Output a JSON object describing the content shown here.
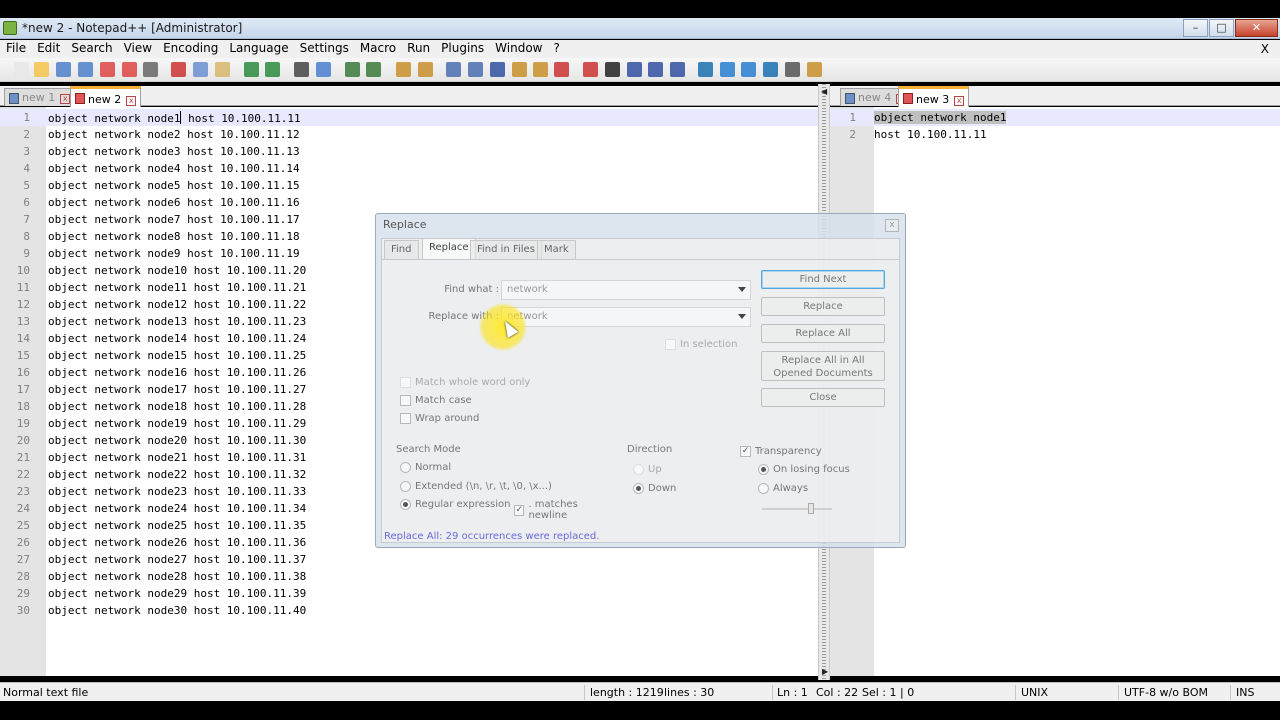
{
  "window": {
    "title": "*new  2 - Notepad++ [Administrator]"
  },
  "menu": [
    "File",
    "Edit",
    "Search",
    "View",
    "Encoding",
    "Language",
    "Settings",
    "Macro",
    "Run",
    "Plugins",
    "Window",
    "?"
  ],
  "menu_close_glyph": "X",
  "toolbar_icons": [
    "new-file",
    "open-file",
    "save",
    "save-all",
    "close",
    "close-all",
    "print",
    "cut",
    "copy",
    "paste",
    "undo",
    "redo",
    "find",
    "replace",
    "zoom-in",
    "zoom-out",
    "sync-vertical",
    "sync-horizontal",
    "word-wrap",
    "show-all-chars",
    "indent-guide",
    "user-lang",
    "doc-map",
    "function-list",
    "record-macro",
    "stop-record",
    "play-macro",
    "run-macro-multiple",
    "save-macro",
    "bookmark-toggle",
    "bookmark-prev",
    "bookmark-next",
    "bookmark-clear",
    "spell-check",
    "launch"
  ],
  "left_pane": {
    "tabs": [
      {
        "label": "new  1",
        "active": false
      },
      {
        "label": "new  2",
        "active": true
      }
    ],
    "lines": [
      "object network node1 host 10.100.11.11",
      "object network node2 host 10.100.11.12",
      "object network node3 host 10.100.11.13",
      "object network node4 host 10.100.11.14",
      "object network node5 host 10.100.11.15",
      "object network node6 host 10.100.11.16",
      "object network node7 host 10.100.11.17",
      "object network node8 host 10.100.11.18",
      "object network node9 host 10.100.11.19",
      "object network node10 host 10.100.11.20",
      "object network node11 host 10.100.11.21",
      "object network node12 host 10.100.11.22",
      "object network node13 host 10.100.11.23",
      "object network node14 host 10.100.11.24",
      "object network node15 host 10.100.11.25",
      "object network node16 host 10.100.11.26",
      "object network node17 host 10.100.11.27",
      "object network node18 host 10.100.11.28",
      "object network node19 host 10.100.11.29",
      "object network node20 host 10.100.11.30",
      "object network node21 host 10.100.11.31",
      "object network node22 host 10.100.11.32",
      "object network node23 host 10.100.11.33",
      "object network node24 host 10.100.11.34",
      "object network node25 host 10.100.11.35",
      "object network node26 host 10.100.11.36",
      "object network node27 host 10.100.11.37",
      "object network node28 host 10.100.11.38",
      "object network node29 host 10.100.11.39",
      "object network node30 host 10.100.11.40"
    ]
  },
  "right_pane": {
    "tabs": [
      {
        "label": "new  4",
        "active": false
      },
      {
        "label": "new  3",
        "active": true
      }
    ],
    "lines": [
      "object network node1",
      "host 10.100.11.11"
    ]
  },
  "replace_dialog": {
    "title": "Replace",
    "close_glyph": "x",
    "tabs": [
      "Find",
      "Replace",
      "Find in Files",
      "Mark"
    ],
    "active_tab": "Replace",
    "find_what_label": "Find what :",
    "find_what_value": "network",
    "replace_with_label": "Replace with :",
    "replace_with_value": "network",
    "in_selection_label": "In selection",
    "buttons": {
      "find_next": "Find Next",
      "replace": "Replace",
      "replace_all": "Replace All",
      "replace_all_opened": "Replace All in All Opened Documents",
      "close": "Close"
    },
    "options": {
      "match_whole_word": "Match whole word only",
      "match_case": "Match case",
      "wrap_around": "Wrap around"
    },
    "search_mode": {
      "title": "Search Mode",
      "normal": "Normal",
      "extended": "Extended (\\n, \\r, \\t, \\0, \\x...)",
      "regex": "Regular expression",
      "matches_newline": ". matches newline",
      "selected": "regex"
    },
    "direction": {
      "title": "Direction",
      "up": "Up",
      "down": "Down",
      "selected": "down"
    },
    "transparency": {
      "title": "Transparency",
      "on_losing_focus": "On losing focus",
      "always": "Always",
      "selected": "on_losing_focus",
      "checked": true
    },
    "status_message": "Replace All: 29 occurrences were replaced."
  },
  "statusbar": {
    "file_type": "Normal text file",
    "length": "length : 1219",
    "lines": "lines : 30",
    "ln": "Ln : 1",
    "col": "Col : 22",
    "sel": "Sel : 1 | 0",
    "eol": "UNIX",
    "encoding": "UTF-8 w/o BOM",
    "mode": "INS"
  },
  "split_arrows": {
    "left": "◀",
    "right": "▶"
  },
  "check_glyph": "✓"
}
